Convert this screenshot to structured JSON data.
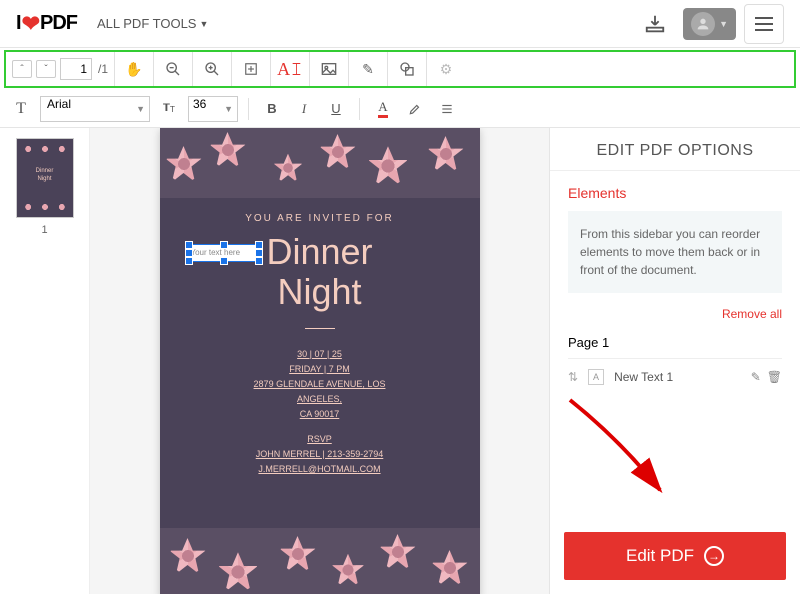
{
  "logo": {
    "prefix": "I",
    "suffix": "PDF"
  },
  "menu": {
    "all_tools": "ALL PDF TOOLS"
  },
  "toolbar": {
    "page_current": "1",
    "page_total": "/1",
    "add_text_glyph": "A𝙸"
  },
  "format": {
    "font": "Arial",
    "size": "36",
    "bold": "B",
    "italic": "I",
    "underline": "U"
  },
  "thumb": {
    "page_num": "1",
    "title1": "Dinner",
    "title2": "Night"
  },
  "doc": {
    "invited": "YOU ARE INVITED FOR",
    "placeholder": "Your text here",
    "title1": "Dinner",
    "title2": "Night",
    "date": "30 | 07 | 25",
    "day": "FRIDAY | 7 PM",
    "addr1": "2879 GLENDALE AVENUE, LOS",
    "addr2": "ANGELES,",
    "addr3": "CA 90017",
    "rsvp": "RSVP",
    "contact": "JOHN MERREL | 213-359-2794",
    "email": "J.MERRELL@HOTMAIL.COM"
  },
  "sidebar": {
    "title": "EDIT PDF OPTIONS",
    "elements_label": "Elements",
    "info": "From this sidebar you can reorder elements to move them back or in front of the document.",
    "remove_all": "Remove all",
    "page_label": "Page 1",
    "item1": "New Text 1",
    "edit_button": "Edit PDF"
  }
}
